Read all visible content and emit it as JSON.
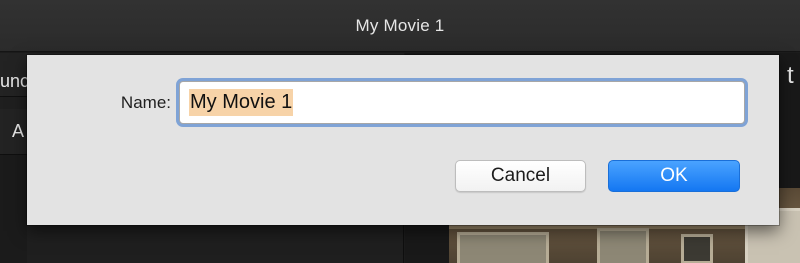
{
  "window": {
    "title": "My Movie 1"
  },
  "background": {
    "edge_texts": [
      "unc",
      "A",
      "t"
    ]
  },
  "dialog": {
    "name_label": "Name:",
    "name_value": "My Movie 1",
    "cancel_label": "Cancel",
    "ok_label": "OK"
  },
  "colors": {
    "accent": "#1477f2",
    "focus_ring": "#7fa3d6",
    "selection": "#f7d3a8"
  }
}
